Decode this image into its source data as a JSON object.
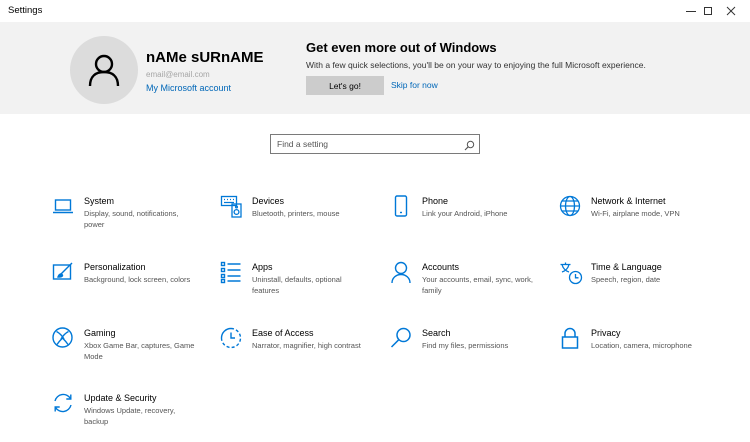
{
  "window": {
    "title": "Settings"
  },
  "account": {
    "name": "nAMe sURnAME",
    "email": "email@email.com",
    "link": "My Microsoft account"
  },
  "promo": {
    "title": "Get even more out of Windows",
    "description": "With a few quick selections, you'll be on your way to enjoying the full Microsoft experience.",
    "button_label": "Let's go!",
    "skip_label": "Skip for now"
  },
  "search": {
    "placeholder": "Find a setting"
  },
  "categories": [
    {
      "title": "System",
      "desc": "Display, sound, notifications, power",
      "icon": "laptop-icon"
    },
    {
      "title": "Devices",
      "desc": "Bluetooth, printers, mouse",
      "icon": "keyboard-speaker-icon"
    },
    {
      "title": "Phone",
      "desc": "Link your Android, iPhone",
      "icon": "phone-icon"
    },
    {
      "title": "Network & Internet",
      "desc": "Wi-Fi, airplane mode, VPN",
      "icon": "globe-icon"
    },
    {
      "title": "Personalization",
      "desc": "Background, lock screen, colors",
      "icon": "paintbrush-icon"
    },
    {
      "title": "Apps",
      "desc": "Uninstall, defaults, optional features",
      "icon": "apps-list-icon"
    },
    {
      "title": "Accounts",
      "desc": "Your accounts, email, sync, work, family",
      "icon": "person-icon"
    },
    {
      "title": "Time & Language",
      "desc": "Speech, region, date",
      "icon": "time-language-icon"
    },
    {
      "title": "Gaming",
      "desc": "Xbox Game Bar, captures, Game Mode",
      "icon": "xbox-icon"
    },
    {
      "title": "Ease of Access",
      "desc": "Narrator, magnifier, high contrast",
      "icon": "ease-of-access-icon"
    },
    {
      "title": "Search",
      "desc": "Find my files, permissions",
      "icon": "magnifier-icon"
    },
    {
      "title": "Privacy",
      "desc": "Location, camera, microphone",
      "icon": "lock-icon"
    },
    {
      "title": "Update & Security",
      "desc": "Windows Update, recovery, backup",
      "icon": "sync-arrows-icon"
    }
  ],
  "colors": {
    "accent": "#0078d7",
    "link": "#0067b8",
    "hero_bg": "#f2f2f2"
  }
}
